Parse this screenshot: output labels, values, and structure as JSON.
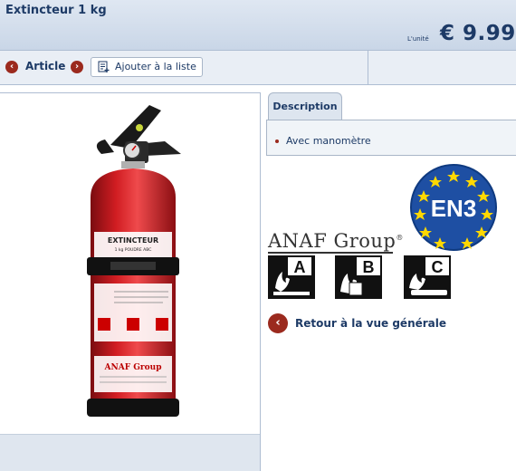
{
  "header": {
    "title": "Extincteur 1 kg",
    "price_unit": "L'unité",
    "price": "€ 9.99"
  },
  "toolbar": {
    "article_label": "Article",
    "add_to_list_label": "Ajouter à la liste"
  },
  "description": {
    "tab_label": "Description",
    "items": [
      "Avec manomètre"
    ]
  },
  "badges": {
    "en3_label": "EN3",
    "brand": "ANAF Group",
    "classes": [
      "A",
      "B",
      "C"
    ]
  },
  "product_label": {
    "name": "EXTINCTEUR",
    "subtitle": "1 kg POUDRE ABC",
    "brand": "ANAF Group"
  },
  "return_label": "Retour à la vue générale",
  "colors": {
    "accent_red": "#9b2a1e",
    "navy": "#1d3a66",
    "eu_blue": "#1e4fa3",
    "eu_yellow": "#ffd800",
    "extinguisher_red": "#c8161d"
  },
  "icons": {
    "prev": "chevron-left-icon",
    "next": "chevron-right-icon",
    "add_list": "list-add-icon",
    "return": "arrow-left-icon"
  }
}
